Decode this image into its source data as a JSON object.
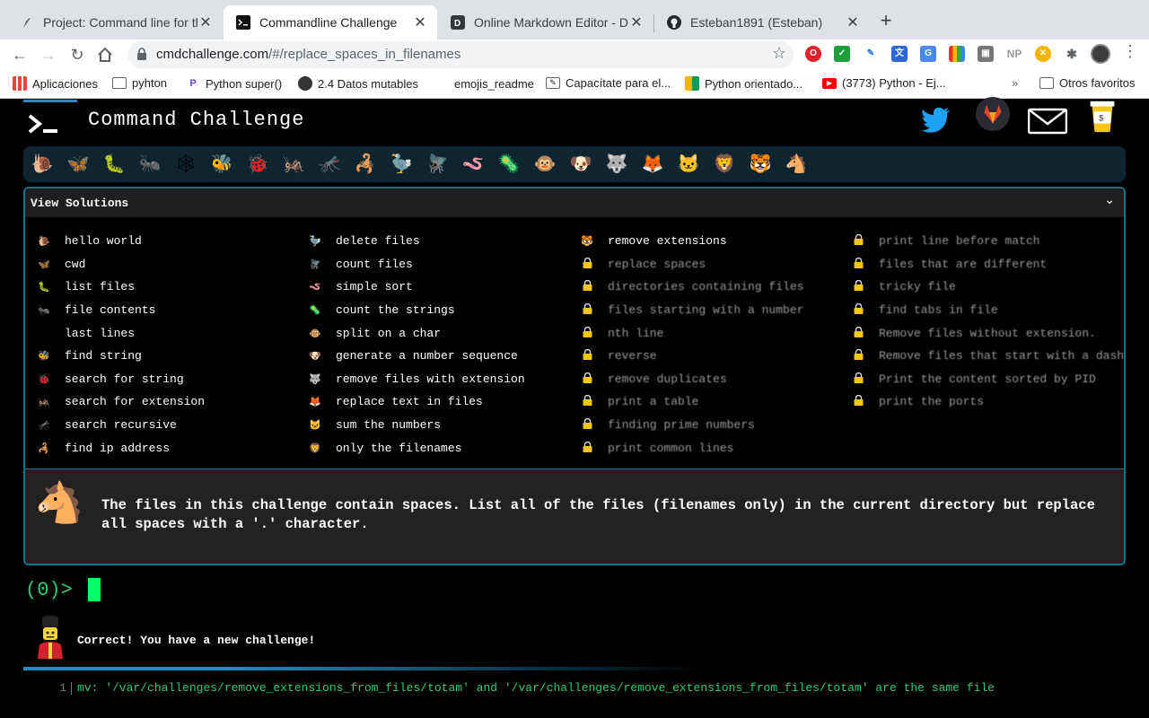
{
  "browser": {
    "tabs": [
      {
        "title": "Project: Command line for the",
        "favicon": "feather-icon",
        "active": false
      },
      {
        "title": "Commandline Challenge",
        "favicon": "terminal-icon",
        "active": true
      },
      {
        "title": "Online Markdown Editor - Dillin",
        "favicon": "dillinger-icon",
        "active": false
      },
      {
        "title": "Esteban1891 (Esteban)",
        "favicon": "github-icon",
        "active": false
      }
    ],
    "url_host": "cmdchallenge.com",
    "url_path": "/#/replace_spaces_in_filenames",
    "bookmarks": [
      {
        "label": "Aplicaciones",
        "icon": "apps-grid-icon"
      },
      {
        "label": "pyhton",
        "icon": "folder-icon"
      },
      {
        "label": "Python super()",
        "icon": "p-icon"
      },
      {
        "label": "2.4 Datos mutables",
        "icon": "globe-icon"
      },
      {
        "label": "emojis_readme",
        "icon": "page-icon"
      },
      {
        "label": "Capacítate para el...",
        "icon": "edit-icon"
      },
      {
        "label": "Python orientado...",
        "icon": "squares-icon"
      },
      {
        "label": "(3773) Python - Ej...",
        "icon": "youtube-icon"
      },
      {
        "label": "Otros favoritos",
        "icon": "folder-icon"
      }
    ],
    "extension_badge": "NP"
  },
  "site": {
    "title": "Command Challenge",
    "view_solutions": "View Solutions",
    "social": [
      "twitter-icon",
      "gitlab-icon",
      "mail-icon",
      "donate-cup-icon"
    ]
  },
  "solutions": {
    "col1": [
      {
        "label": "hello world",
        "icon": "🐌"
      },
      {
        "label": "cwd",
        "icon": "🦋"
      },
      {
        "label": "list files",
        "icon": "🐛"
      },
      {
        "label": "file contents",
        "icon": "🐜"
      },
      {
        "label": "last lines",
        "icon": "🕸"
      },
      {
        "label": "find string",
        "icon": "🐝"
      },
      {
        "label": "search for string",
        "icon": "🐞"
      },
      {
        "label": "search for extension",
        "icon": "🦗"
      },
      {
        "label": "search recursive",
        "icon": "🦟"
      },
      {
        "label": "find ip address",
        "icon": "🦂"
      }
    ],
    "col2": [
      {
        "label": "delete files",
        "icon": "🦤"
      },
      {
        "label": "count files",
        "icon": "🪰"
      },
      {
        "label": "simple sort",
        "icon": "🪱"
      },
      {
        "label": "count the strings",
        "icon": "🦠"
      },
      {
        "label": "split on a char",
        "icon": "🐵"
      },
      {
        "label": "generate a number sequence",
        "icon": "🐶"
      },
      {
        "label": "remove files with extension",
        "icon": "🐺"
      },
      {
        "label": "replace text in files",
        "icon": "🦊"
      },
      {
        "label": "sum the numbers",
        "icon": "🐱"
      },
      {
        "label": "only the filenames",
        "icon": "🦁"
      }
    ],
    "col3": [
      {
        "label": "remove extensions",
        "icon": "🐯",
        "locked": false
      },
      {
        "label": "replace spaces",
        "locked": true
      },
      {
        "label": "directories containing files",
        "locked": true
      },
      {
        "label": "files starting with a number",
        "locked": true
      },
      {
        "label": "nth line",
        "locked": true
      },
      {
        "label": "reverse",
        "locked": true
      },
      {
        "label": "remove duplicates",
        "locked": true
      },
      {
        "label": "print a table",
        "locked": true
      },
      {
        "label": "finding prime numbers",
        "locked": true
      },
      {
        "label": "print common lines",
        "locked": true
      }
    ],
    "col4": [
      {
        "label": "print line before match",
        "locked": true
      },
      {
        "label": "files that are different",
        "locked": true
      },
      {
        "label": "tricky file",
        "locked": true
      },
      {
        "label": "find tabs in file",
        "locked": true
      },
      {
        "label": "Remove files without extension.",
        "locked": true
      },
      {
        "label": "Remove files that start with a dash",
        "locked": true
      },
      {
        "label": "Print the content sorted by PID",
        "locked": true
      },
      {
        "label": "print the ports",
        "locked": true
      }
    ]
  },
  "critters": [
    "🐌",
    "🦋",
    "🐛",
    "🐜",
    "🕸",
    "🐝",
    "🐞",
    "🦗",
    "🦟",
    "🦂",
    "🦤",
    "🪰",
    "🪱",
    "🦠",
    "🐵",
    "🐶",
    "🐺",
    "🦊",
    "🐱",
    "🦁",
    "🐯",
    "🐴"
  ],
  "challenge": {
    "description": "The files in this challenge contain spaces. List all of the files (filenames only) in the current directory but replace all spaces with a '.' character."
  },
  "terminal": {
    "prompt": "(0)> ",
    "message": "Correct! You have a new challenge!",
    "output": [
      {
        "line": "1",
        "text": "mv: '/var/challenges/remove_extensions_from_files/totam' and '/var/challenges/remove_extensions_from_files/totam' are the same file"
      }
    ]
  }
}
